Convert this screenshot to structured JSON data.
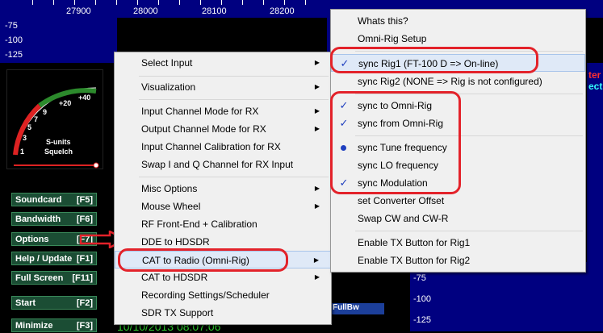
{
  "freq_scale": {
    "labels": [
      "27900",
      "28000",
      "28100",
      "28200"
    ]
  },
  "db_scale": {
    "labels": [
      "-75",
      "-100",
      "-125"
    ]
  },
  "right_scale": {
    "labels": [
      "-75",
      "-100",
      "-125"
    ]
  },
  "smeter": {
    "labels": [
      "+40",
      "+20",
      "9",
      "7",
      "5",
      "3",
      "1"
    ],
    "caption_1": "S-units",
    "caption_2": "Squelch"
  },
  "side_buttons": [
    {
      "label": "Soundcard",
      "key": "[F5]"
    },
    {
      "label": "Bandwidth",
      "key": "[F6]"
    },
    {
      "label": "Options",
      "key": "[F7]"
    },
    {
      "label": "Help / Update",
      "key": "[F1]"
    },
    {
      "label": "Full Screen",
      "key": "[F11]"
    },
    {
      "label": "Start",
      "key": "[F2]"
    },
    {
      "label": "Minimize",
      "key": "[F3]"
    }
  ],
  "status": {
    "datetime": "10/10/2013 08:07:06",
    "fullbw": "FullBw",
    "right_text_1": "ter",
    "right_text_2": "ectr"
  },
  "main_menu": {
    "items": [
      {
        "label": "Select Input",
        "submenu": true
      },
      {
        "label": "Visualization",
        "submenu": true
      },
      {
        "label": "Input Channel Mode for RX",
        "submenu": true
      },
      {
        "label": "Output Channel Mode for RX",
        "submenu": true
      },
      {
        "label": "Input Channel Calibration for RX",
        "submenu": false
      },
      {
        "label": "Swap I and Q Channel for RX Input",
        "submenu": false
      },
      {
        "label": "Misc Options",
        "submenu": true
      },
      {
        "label": "Mouse Wheel",
        "submenu": true
      },
      {
        "label": "RF Front-End + Calibration",
        "submenu": false
      },
      {
        "label": "DDE to HDSDR",
        "submenu": false
      },
      {
        "label": "CAT to Radio (Omni-Rig)",
        "submenu": true
      },
      {
        "label": "CAT to HDSDR",
        "submenu": true
      },
      {
        "label": "Recording Settings/Scheduler",
        "submenu": false
      },
      {
        "label": "SDR TX Support",
        "submenu": false
      }
    ]
  },
  "sub_menu": {
    "items": [
      {
        "label": "Whats this?",
        "mark": ""
      },
      {
        "label": "Omni-Rig Setup",
        "mark": ""
      },
      {
        "label": "sync Rig1  (FT-100 D => On-line)",
        "mark": "check"
      },
      {
        "label": "sync Rig2  (NONE => Rig is not configured)",
        "mark": ""
      },
      {
        "label": "sync to Omni-Rig",
        "mark": "check"
      },
      {
        "label": "sync from Omni-Rig",
        "mark": "check"
      },
      {
        "label": "sync Tune frequency",
        "mark": "radio"
      },
      {
        "label": "sync LO frequency",
        "mark": ""
      },
      {
        "label": "sync Modulation",
        "mark": "check"
      },
      {
        "label": "set Converter Offset",
        "mark": ""
      },
      {
        "label": "Swap CW and CW-R",
        "mark": ""
      },
      {
        "label": "Enable TX Button for Rig1",
        "mark": ""
      },
      {
        "label": "Enable TX Button for Rig2",
        "mark": ""
      }
    ]
  },
  "glyphs": {
    "check": "✓",
    "submenu_arrow": "▶"
  },
  "colors": {
    "highlight_oval": "#e3222a",
    "check_color": "#1f3fbf",
    "arrow_color": "#e3222a"
  }
}
